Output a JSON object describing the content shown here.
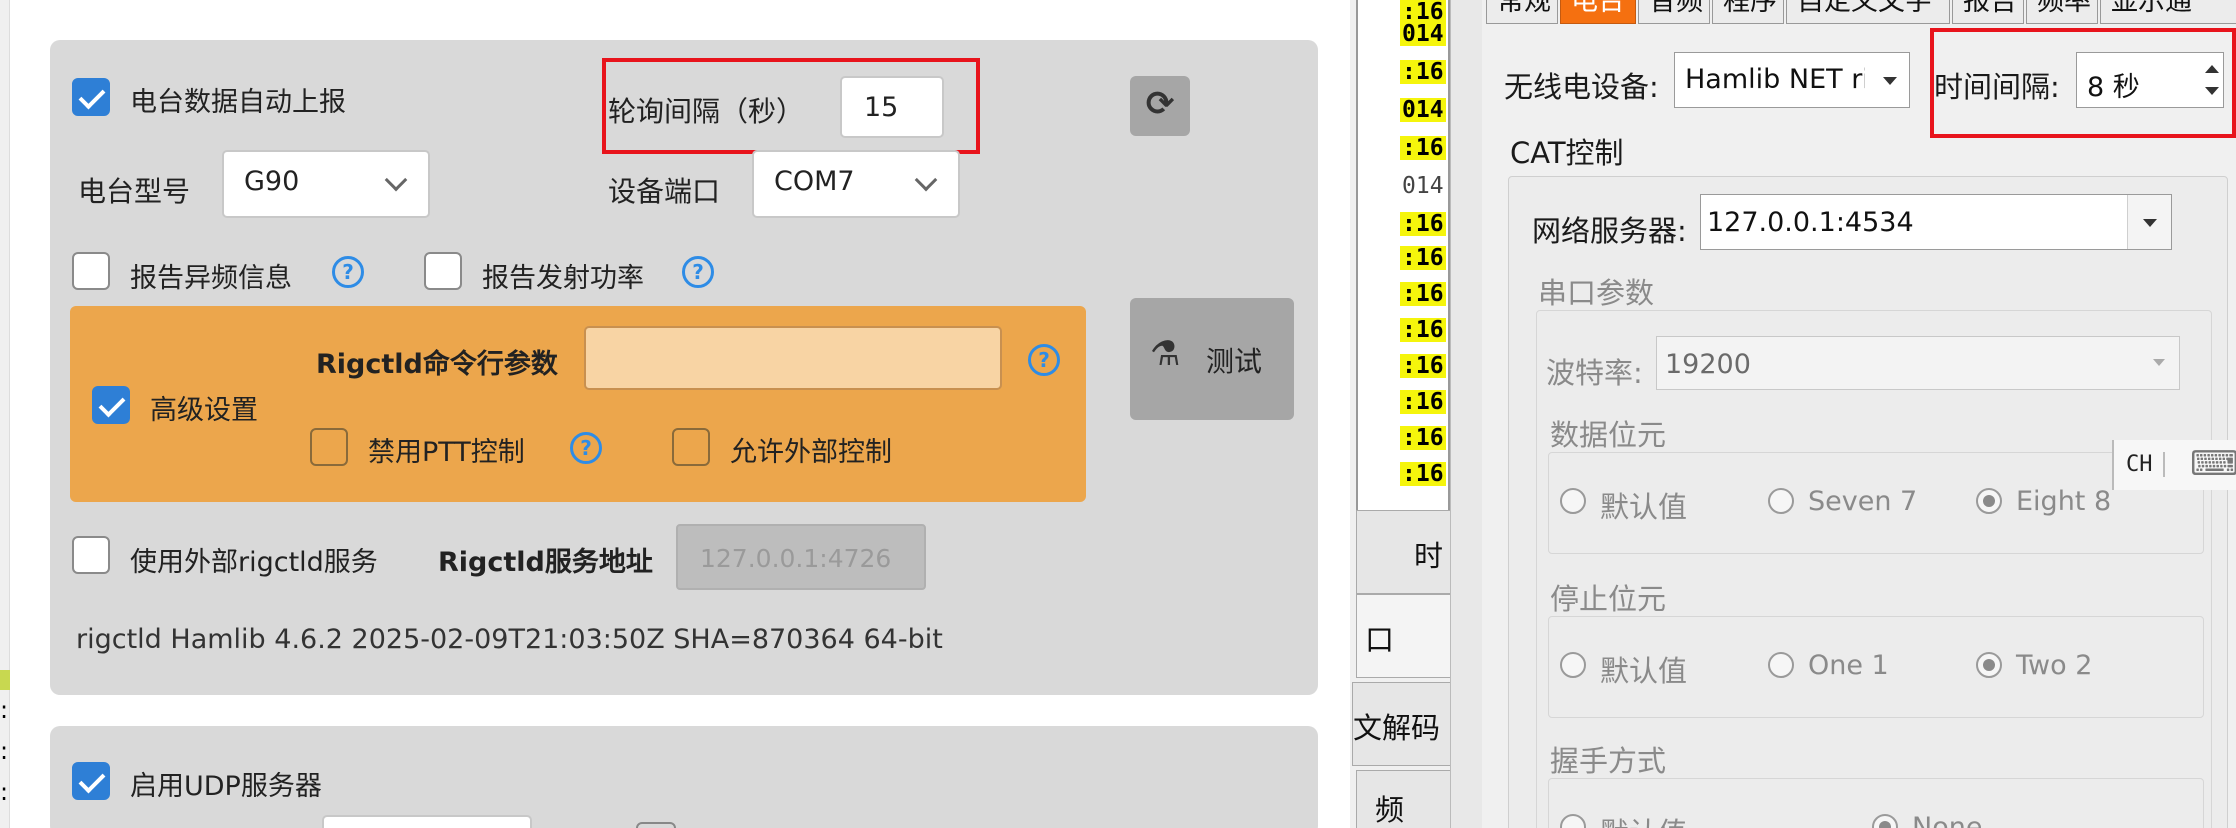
{
  "left": {
    "radio_card": {
      "auto_report_label": "电台数据自动上报",
      "poll_interval_label": "轮询间隔（秒）",
      "poll_interval_value": "15",
      "radio_model_label": "电台型号",
      "radio_model_value": "G90",
      "device_port_label": "设备端口",
      "device_port_value": "COM7",
      "report_offfreq_label": "报告异频信息",
      "report_power_label": "报告发射功率",
      "advanced_label": "高级设置",
      "rigctld_args_label": "Rigctld命令行参数",
      "rigctld_args_value": "",
      "disable_ptt_label": "禁用PTT控制",
      "allow_external_label": "允许外部控制",
      "test_label": "测试",
      "use_external_label": "使用外部rigctld服务",
      "rigctld_addr_label": "Rigctld服务地址",
      "rigctld_addr_value": "127.0.0.1:4726",
      "version_text": "rigctld Hamlib 4.6.2 2025-02-09T21:03:50Z SHA=870364 64-bit",
      "help_glyph": "?",
      "refresh_glyph": "⟳",
      "flask_glyph": "⚗"
    },
    "udp_card": {
      "enable_udp_label": "启用UDP服务器"
    },
    "edge_dots": [
      ":",
      ":",
      ":"
    ]
  },
  "middle": {
    "timestamps": [
      {
        "text": ":16",
        "style": "yellow"
      },
      {
        "text": "014",
        "style": "yellow"
      },
      {
        "text": ":16",
        "style": "yellow"
      },
      {
        "text": "014",
        "style": "yellow"
      },
      {
        "text": ":16",
        "style": "yellow"
      },
      {
        "text": "014",
        "style": "white"
      },
      {
        "text": ":16",
        "style": "yellow"
      },
      {
        "text": ":16",
        "style": "yellow"
      },
      {
        "text": ":16",
        "style": "yellow"
      },
      {
        "text": ":16",
        "style": "yellow"
      },
      {
        "text": ":16",
        "style": "yellow"
      },
      {
        "text": ":16",
        "style": "yellow"
      },
      {
        "text": ":16",
        "style": "yellow"
      },
      {
        "text": ":16",
        "style": "yellow"
      }
    ],
    "side_buttons": [
      "时",
      "口",
      "文解码",
      "频"
    ]
  },
  "right": {
    "tabs": [
      "常规",
      "电台",
      "音频",
      "程序",
      "自定义文字",
      "报告",
      "频率",
      "显示通"
    ],
    "active_tab": 1,
    "radio_device_label": "无线电设备:",
    "radio_device_value": "Hamlib NET rig",
    "time_interval_label": "时间间隔:",
    "time_interval_value": "8 秒",
    "cat_label": "CAT控制",
    "net_server_label": "网络服务器:",
    "net_server_value": "127.0.0.1:4534",
    "serial_params_label": "串口参数",
    "baud_label": "波特率:",
    "baud_value": "19200",
    "data_bits_label": "数据位元",
    "data_bits_options": [
      "默认值",
      "Seven 7",
      "Eight 8"
    ],
    "data_bits_selected": 2,
    "stop_bits_label": "停止位元",
    "stop_bits_options": [
      "默认值",
      "One 1",
      "Two 2"
    ],
    "stop_bits_selected": 2,
    "handshake_label": "握手方式",
    "handshake_partial": [
      "默认值",
      "None"
    ],
    "ime_label": "CH",
    "keyboard_icon": "⌨"
  }
}
